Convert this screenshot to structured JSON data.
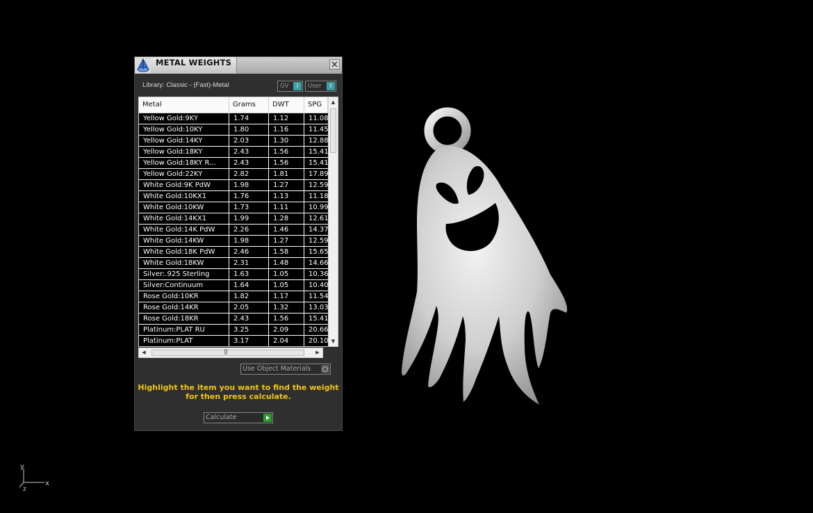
{
  "window": {
    "title": "METAL WEIGHTS",
    "library_label": "Library: Classic - (Fast)-Metal",
    "gv_toggle": "GV",
    "user_toggle": "User",
    "toggle_indicator": "I"
  },
  "table": {
    "columns": [
      "Metal",
      "Grams",
      "DWT",
      "SPG"
    ],
    "rows": [
      [
        "Yellow Gold:9KY",
        "1.74",
        "1.12",
        "11.08"
      ],
      [
        "Yellow Gold:10KY",
        "1.80",
        "1.16",
        "11.45"
      ],
      [
        "Yellow Gold:14KY",
        "2.03",
        "1.30",
        "12.88"
      ],
      [
        "Yellow Gold:18KY",
        "2.43",
        "1.56",
        "15.41"
      ],
      [
        "Yellow Gold:18KY R...",
        "2.43",
        "1.56",
        "15.41"
      ],
      [
        "Yellow Gold:22KY",
        "2.82",
        "1.81",
        "17.89"
      ],
      [
        "White Gold:9K PdW",
        "1.98",
        "1.27",
        "12.59"
      ],
      [
        "White Gold:10KX1",
        "1.76",
        "1.13",
        "11.18"
      ],
      [
        "White Gold:10KW",
        "1.73",
        "1.11",
        "10.99"
      ],
      [
        "White Gold:14KX1",
        "1.99",
        "1.28",
        "12.61"
      ],
      [
        "White Gold:14K PdW",
        "2.26",
        "1.46",
        "14.37"
      ],
      [
        "White Gold:14KW",
        "1.98",
        "1.27",
        "12.59"
      ],
      [
        "White Gold:18K PdW",
        "2.46",
        "1.58",
        "15.65"
      ],
      [
        "White Gold:18KW",
        "2.31",
        "1.48",
        "14.66"
      ],
      [
        "Silver:.925 Sterling",
        "1.63",
        "1.05",
        "10.36"
      ],
      [
        "Silver:Continuum",
        "1.64",
        "1.05",
        "10.40"
      ],
      [
        "Rose Gold:10KR",
        "1.82",
        "1.17",
        "11.54"
      ],
      [
        "Rose Gold:14KR",
        "2.05",
        "1.32",
        "13.03"
      ],
      [
        "Rose Gold:18KR",
        "2.43",
        "1.56",
        "15.41"
      ],
      [
        "Platinum:PLAT RU",
        "3.25",
        "2.09",
        "20.66"
      ],
      [
        "Platinum:PLAT",
        "3.17",
        "2.04",
        "20.10"
      ]
    ]
  },
  "use_object_materials": "Use Object Materials",
  "instruction": [
    "Highlight the item you want to find the weight",
    "for then press calculate."
  ],
  "calculate_button": "Calculate",
  "axis": {
    "y_label": "y",
    "x_label": "x",
    "z_label": "z"
  },
  "colors": {
    "background": "#000000",
    "panel": "#2f2f2f",
    "instruction_text": "#f0c419",
    "toggle_accent": "#3aa0a5",
    "calculate_go": "#2e9a2e"
  },
  "icons": [
    "app-logo-icon",
    "close-icon",
    "toggle-indicator-icon",
    "scroll-up-icon",
    "scroll-down-icon",
    "scroll-left-icon",
    "scroll-right-icon",
    "radio-icon",
    "play-icon"
  ]
}
